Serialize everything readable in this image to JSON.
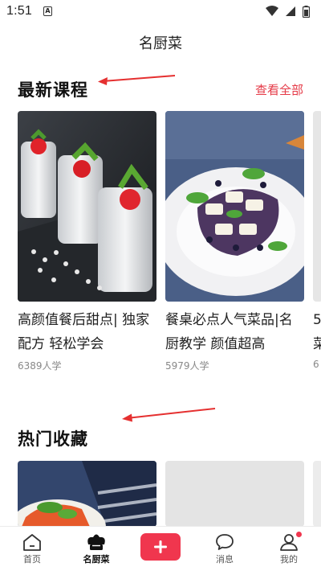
{
  "status_bar": {
    "time": "1:51"
  },
  "header": {
    "title": "名厨菜"
  },
  "latest": {
    "title": "最新课程",
    "see_all": "查看全部",
    "cards": [
      {
        "title": "高颜值餐后甜点| 独家配方 轻松学会",
        "learners": "6389人学"
      },
      {
        "title": "餐桌必点人气菜品|名厨教学 颜值超高",
        "learners": "5979人学"
      },
      {
        "title": "5菜",
        "learners": "6"
      }
    ]
  },
  "favorites": {
    "title": "热门收藏"
  },
  "nav": {
    "items": [
      {
        "label": "首页"
      },
      {
        "label": "名厨菜"
      },
      {
        "label": ""
      },
      {
        "label": "消息"
      },
      {
        "label": "我的"
      }
    ]
  },
  "colors": {
    "accent": "#f0364e",
    "see_all": "#e53a47",
    "annotation_arrow": "#e53030"
  }
}
